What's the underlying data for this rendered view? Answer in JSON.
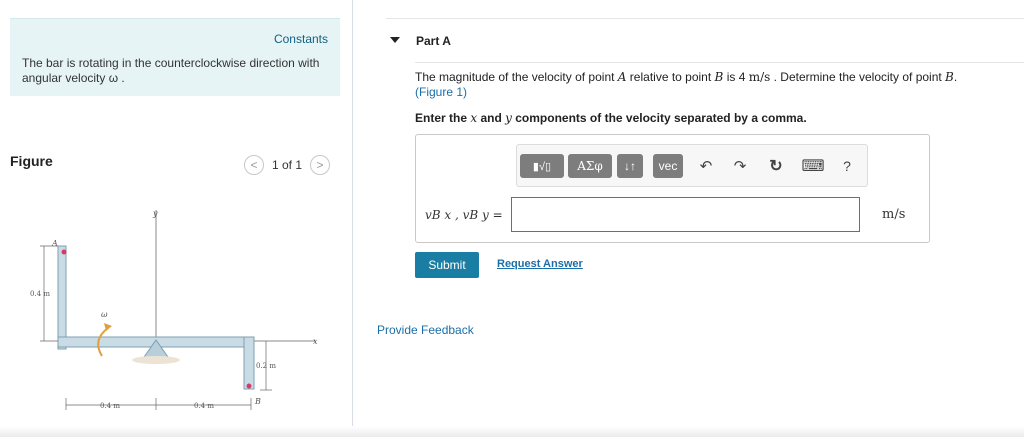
{
  "left": {
    "constants_label": "Constants",
    "intro_text": "The bar is rotating in the counterclockwise direction with angular velocity ω .",
    "figure_title": "Figure",
    "pager": {
      "text": "1 of 1",
      "prev_glyph": "<",
      "next_glyph": ">"
    },
    "figure_labels": {
      "y": "y",
      "x": "x",
      "A": "A",
      "B": "B",
      "omega": "ω",
      "dim_04_vertical": "0.4 m",
      "dim_02": "0.2 m",
      "dim_04_left": "0.4 m",
      "dim_04_right": "0.4 m"
    }
  },
  "part": {
    "title": "Part A",
    "question": {
      "t1": "The magnitude of the velocity of point ",
      "A": "A",
      "t2": " relative to point ",
      "B1": "B",
      "t3": " is 4 ",
      "unit": "m/s",
      "t4": " . Determine the velocity of point ",
      "B2": "B",
      "t5": ".",
      "figure_link": "(Figure 1)"
    },
    "instruction": {
      "t1": "Enter the ",
      "x": "x",
      "t2": " and ",
      "y": "y",
      "t3": " components of the velocity separated by a comma."
    },
    "toolbar": {
      "templates_glyph": "▮√▯",
      "greek": "ΑΣφ",
      "arrows": "↓↑",
      "vec": "vec",
      "undo": "↶",
      "redo": "↷",
      "reset": "↻",
      "keyboard": "⌨",
      "help": "?"
    },
    "equation_label": "vB x , vB y  =",
    "answer_value": "",
    "unit": "m/s",
    "submit_label": "Submit",
    "request_label": "Request Answer"
  },
  "feedback_label": "Provide Feedback"
}
